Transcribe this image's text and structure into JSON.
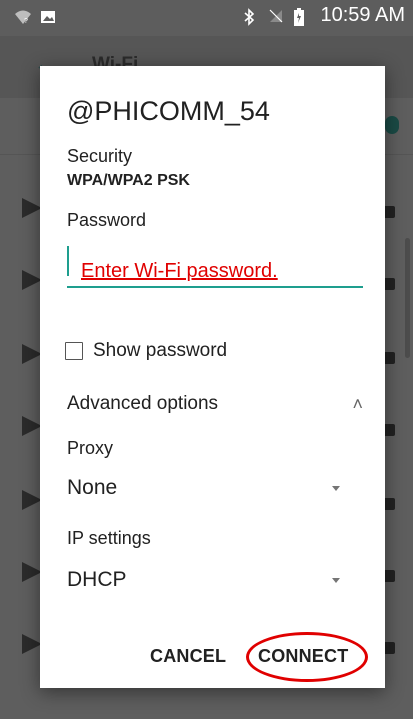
{
  "status_bar": {
    "time": "10:59 AM",
    "icons": [
      "wifi-question-icon",
      "image-icon",
      "bluetooth-icon",
      "no-sim-icon",
      "battery-icon"
    ]
  },
  "background": {
    "app_title": "Wi-Fi"
  },
  "dialog": {
    "title": "@PHICOMM_54",
    "security_label": "Security",
    "security_value": "WPA/WPA2 PSK",
    "password_label": "Password",
    "password_placeholder": "Enter Wi-Fi password.",
    "show_password_label": "Show password",
    "show_password_checked": false,
    "advanced_options_label": "Advanced options",
    "proxy_label": "Proxy",
    "proxy_value": "None",
    "ip_settings_label": "IP settings",
    "ip_settings_value": "DHCP",
    "cancel_label": "CANCEL",
    "connect_label": "CONNECT"
  },
  "colors": {
    "accent": "#1e9e8e",
    "annotation": "#e00000",
    "scrim": "#5e5e5e"
  }
}
